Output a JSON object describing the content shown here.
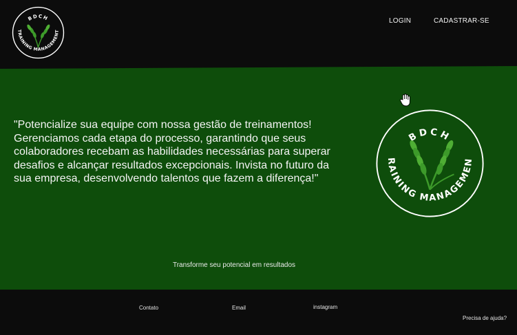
{
  "header": {
    "logo": {
      "top_text": "BDCH",
      "arc_text": "TRAINING MANAGEMENT"
    },
    "nav": {
      "login": "LOGIN",
      "signup": "CADASTRAR-SE"
    }
  },
  "hero": {
    "text": "\"Potencialize sua equipe com nossa gestão de treinamentos! Gerenciamos cada etapa do processo, garantindo que seus colaboradores recebam as habilidades necessárias para superar desafios e alcançar resultados excepcionais. Invista no futuro da sua empresa, desenvolvendo talentos que fazem a diferença!\"",
    "tagline": "Transforme seu potencial em resultados",
    "cursor_icon": "hand-pointer-icon"
  },
  "footer": {
    "contato": "Contato",
    "email": "Email",
    "instagram": "instagram",
    "help": "Precisa de ajuda?"
  },
  "colors": {
    "dark": "#0c0c0c",
    "green": "#0e4d0b",
    "wheat": "#3d9a2a"
  }
}
